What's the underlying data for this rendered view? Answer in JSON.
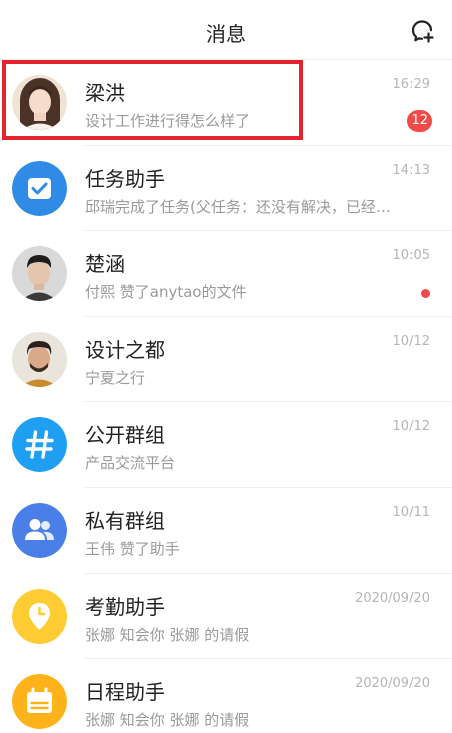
{
  "header": {
    "title": "消息"
  },
  "conversations": [
    {
      "name": "梁洪",
      "preview": "设计工作进行得怎么样了",
      "time": "16:29",
      "badge": "12"
    },
    {
      "name": "任务助手",
      "preview": "邱瑞完成了任务(父任务：还没有解决，已经…",
      "time": "14:13"
    },
    {
      "name": "楚涵",
      "preview": "付熙 赞了anytao的文件",
      "time": "10:05",
      "unread_dot": true
    },
    {
      "name": "设计之都",
      "preview": "宁夏之行",
      "time": "10/12"
    },
    {
      "name": "公开群组",
      "preview": "产品交流平台",
      "time": "10/12"
    },
    {
      "name": "私有群组",
      "preview": "王伟 赞了助手",
      "time": "10/11"
    },
    {
      "name": "考勤助手",
      "preview": "张娜 知会你 张娜 的请假",
      "time": "2020/09/20"
    },
    {
      "name": "日程助手",
      "preview": "张娜 知会你 张娜 的请假",
      "time": "2020/09/20"
    }
  ],
  "colors": {
    "badge": "#f04b48",
    "highlight": "#e3232d",
    "task_assistant": "#2f8be6",
    "public_group": "#1e9ff2",
    "private_group": "#4a7fe8",
    "attendance": "#ffcc33",
    "schedule": "#ffb21a"
  },
  "icons": {
    "new_chat": "chat-plus-icon",
    "task_assistant": "checkbox-icon",
    "public_group": "hash-icon",
    "private_group": "group-users-icon",
    "attendance": "location-clock-icon",
    "schedule": "calendar-icon"
  }
}
